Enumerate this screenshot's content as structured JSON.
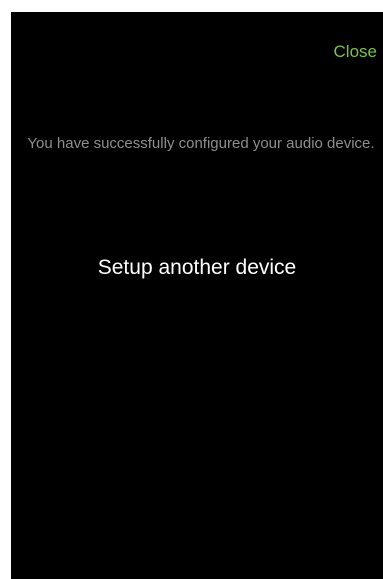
{
  "header": {
    "close_label": "Close"
  },
  "main": {
    "success_message": "You have successfully configured your audio device.",
    "setup_another_label": "Setup another device"
  },
  "colors": {
    "background": "#000000",
    "accent": "#7dc242",
    "message_text": "#8e8e8e",
    "primary_text": "#ffffff"
  }
}
